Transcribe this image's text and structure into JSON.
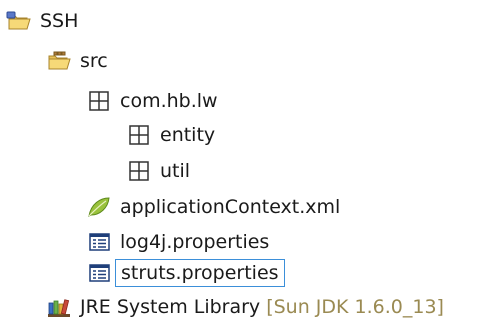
{
  "tree": {
    "project": {
      "label": "SSH",
      "icon": "project-folder-icon"
    },
    "src": {
      "label": "src",
      "icon": "source-folder-icon"
    },
    "package_root": {
      "label": "com.hb.lw",
      "icon": "package-icon"
    },
    "package_entity": {
      "label": "entity",
      "icon": "package-icon"
    },
    "package_util": {
      "label": "util",
      "icon": "package-icon"
    },
    "file_app_context": {
      "label": "applicationContext.xml",
      "icon": "spring-leaf-icon"
    },
    "file_log4j": {
      "label": "log4j.properties",
      "icon": "properties-file-icon"
    },
    "file_struts": {
      "label": "struts.properties",
      "icon": "properties-file-icon",
      "selected": true
    },
    "library": {
      "label": "JRE System Library",
      "annotation": "[Sun JDK 1.6.0_13]",
      "icon": "library-books-icon"
    }
  },
  "colors": {
    "selection_border": "#3b8fd9",
    "annotation_text": "#9a8a52"
  }
}
